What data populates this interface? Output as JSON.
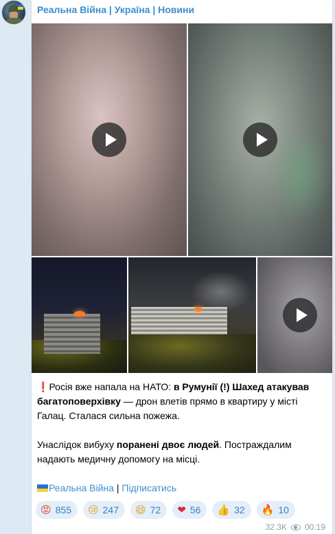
{
  "post": {
    "channel_name": "Реальна Війна | Україна | Новини",
    "text_p1_excl": "❗",
    "text_p1_a": "Росія вже напала на НАТО: ",
    "text_p1_b": "в Румунії (!) Шахед атакував багатоповерхівку",
    "text_p1_c": " — дрон влетів прямо в квартиру у місті Галац. Сталася сильна пожежа.",
    "text_p2_a": "Унаслідок вибуху ",
    "text_p2_b": "поранені двоє людей",
    "text_p2_c": ". Постраждалим надають медичну допомогу на місці.",
    "link_channel": "Реальна Війна",
    "link_separator": " | ",
    "link_subscribe": "Підписатись",
    "views": "32.3K",
    "time": "00:19"
  },
  "media": [
    {
      "type": "video",
      "icon": "play-icon"
    },
    {
      "type": "video",
      "icon": "play-icon"
    },
    {
      "type": "photo"
    },
    {
      "type": "photo"
    },
    {
      "type": "video",
      "icon": "play-icon"
    }
  ],
  "reactions": [
    {
      "emoji": "😡",
      "count": "855"
    },
    {
      "emoji": "😢",
      "count": "247"
    },
    {
      "emoji": "😄",
      "count": "72"
    },
    {
      "emoji": "❤",
      "count": "56"
    },
    {
      "emoji": "👍",
      "count": "32"
    },
    {
      "emoji": "🔥",
      "count": "10"
    }
  ],
  "colors": {
    "background": "#ddeaf3",
    "accent": "#3a8ecf",
    "reaction_bg": "#e3eef8",
    "meta": "#8b9aa8"
  }
}
